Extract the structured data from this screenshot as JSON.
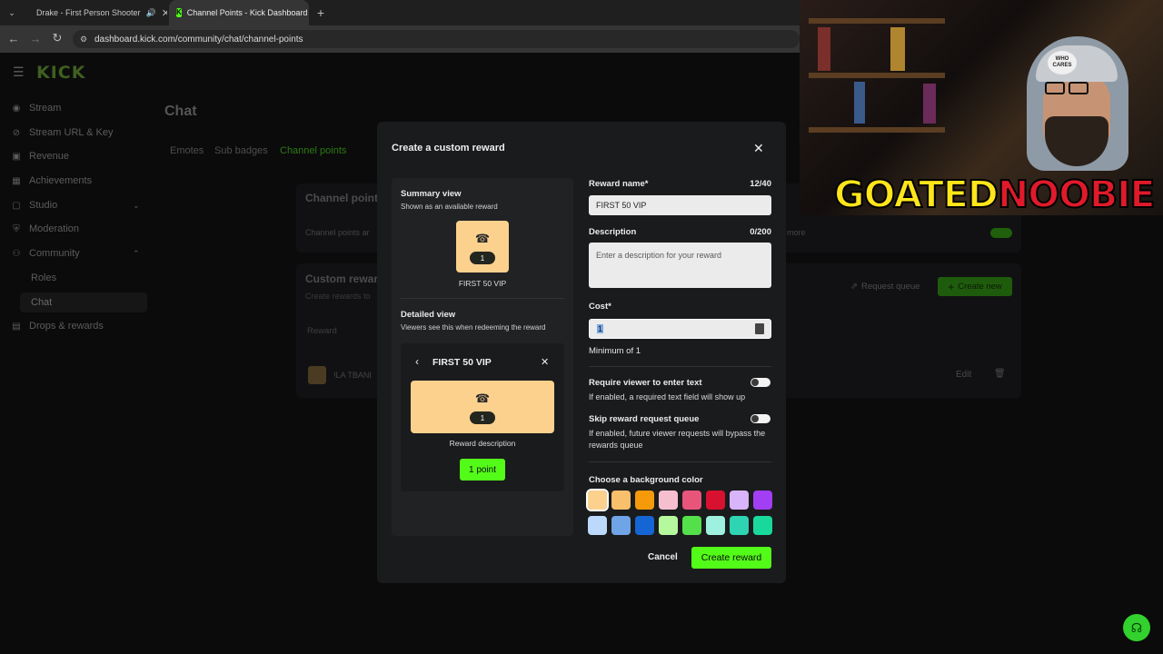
{
  "browser": {
    "tabs": [
      {
        "title": "Drake - First Person Shooter",
        "icon": "youtube-icon"
      },
      {
        "title": "Channel Points - Kick Dashboard",
        "icon": "kick-icon"
      }
    ],
    "url": "dashboard.kick.com/community/chat/channel-points"
  },
  "sidebar": {
    "logo": "KICK",
    "items": [
      {
        "label": "Stream",
        "icon": "stream-icon"
      },
      {
        "label": "Stream URL & Key",
        "icon": "link-icon"
      },
      {
        "label": "Revenue",
        "icon": "revenue-icon"
      },
      {
        "label": "Achievements",
        "icon": "achievements-icon"
      },
      {
        "label": "Studio",
        "icon": "studio-icon"
      },
      {
        "label": "Moderation",
        "icon": "moderation-icon"
      },
      {
        "label": "Community",
        "icon": "community-icon"
      },
      {
        "label": "Drops & rewards",
        "icon": "drops-icon"
      }
    ],
    "community_sub": [
      "Roles",
      "Chat"
    ]
  },
  "main": {
    "title": "Chat",
    "tabs": [
      "Emotes",
      "Sub badges",
      "Channel points"
    ],
    "card1_title": "Channel point",
    "card1_desc": "Channel points ar",
    "card1_more": "more",
    "card2_title": "Custom rewar",
    "card2_desc": "Create rewards to",
    "request_queue": "Request queue",
    "create_new": "Create new",
    "col_reward": "Reward",
    "row_name": "!LA TBANI",
    "row_edit": "Edit"
  },
  "modal": {
    "title": "Create a custom reward",
    "summary_title": "Summary view",
    "summary_sub": "Shown as an available reward",
    "tile_cost": "1",
    "tile_name": "FIRST 50 VIP",
    "detailed_title": "Detailed view",
    "detailed_sub": "Viewers see this when redeeming the reward",
    "detail_name": "FIRST 50 VIP",
    "detail_cost": "1",
    "detail_desc": "Reward description",
    "detail_button": "1 point",
    "reward_name_label": "Reward name*",
    "reward_name_count": "12/40",
    "reward_name_value": "FIRST 50 VIP",
    "description_label": "Description",
    "description_count": "0/200",
    "description_placeholder": "Enter a description for your reward",
    "cost_label": "Cost*",
    "cost_value": "1",
    "cost_min": "Minimum of 1",
    "require_text_label": "Require viewer to enter text",
    "require_text_hint": "If enabled, a required text field will show up",
    "skip_queue_label": "Skip reward request queue",
    "skip_queue_hint": "If enabled, future viewer requests will bypass the rewards queue",
    "bg_color_label": "Choose a background color",
    "colors_row1": [
      "#fcd18e",
      "#f8c06a",
      "#f49a0b",
      "#f6bfcf",
      "#e8557a",
      "#d7112f",
      "#d8b4fb",
      "#a23ef4"
    ],
    "colors_row2": [
      "#bcd8fb",
      "#6fa4e6",
      "#1565d4",
      "#b6f89e",
      "#53e04a",
      "#9ef1df",
      "#2fd4b2",
      "#18d99b"
    ],
    "cancel": "Cancel",
    "create": "Create reward"
  },
  "webcam": {
    "overlay_yellow": "GOATED",
    "overlay_red": "NOOBIE",
    "cap_text": "WHO CARES"
  },
  "colors": {
    "kick_green": "#53fc18",
    "modal_bg": "#1a1b1d"
  }
}
